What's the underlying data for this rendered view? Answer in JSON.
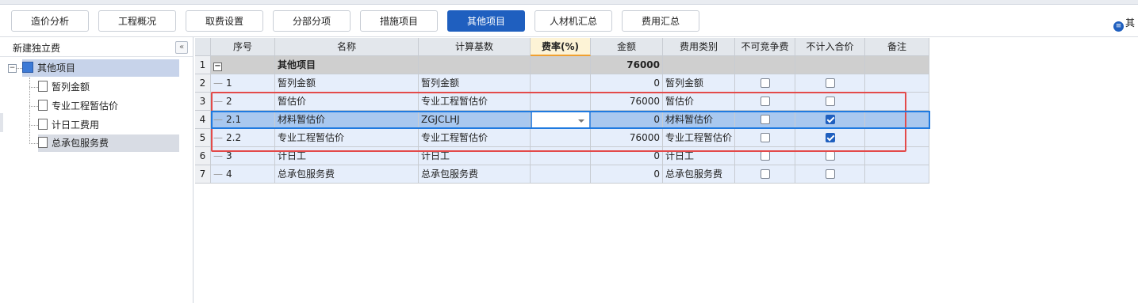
{
  "toolbar": {
    "tabs": [
      {
        "label": "造价分析"
      },
      {
        "label": "工程概况"
      },
      {
        "label": "取费设置"
      },
      {
        "label": "分部分项"
      },
      {
        "label": "措施项目"
      },
      {
        "label": "其他项目"
      },
      {
        "label": "人材机汇总"
      },
      {
        "label": "费用汇总"
      }
    ],
    "active_tab": "其他项目",
    "corner_text": "其"
  },
  "sidebar": {
    "title": "新建独立费",
    "collapse": "«",
    "root": {
      "label": "其他项目",
      "toggle": "−"
    },
    "items": [
      {
        "label": "暂列金额"
      },
      {
        "label": "专业工程暂估价"
      },
      {
        "label": "计日工费用"
      },
      {
        "label": "总承包服务费"
      }
    ]
  },
  "table": {
    "headers": {
      "seq": "序号",
      "name": "名称",
      "basis": "计算基数",
      "rate": "费率(%)",
      "amount": "金额",
      "category": "费用类别",
      "noncompete": "不可竞争费",
      "exclude": "不计入合价",
      "note": "备注"
    },
    "rows": [
      {
        "rownum": "1",
        "seq": "",
        "name": "其他项目",
        "basis": "",
        "rate": "",
        "amount": "76000",
        "category": "",
        "noncompete": null,
        "exclude": null,
        "note": ""
      },
      {
        "rownum": "2",
        "seq": "1",
        "name": "暂列金额",
        "basis": "暂列金额",
        "rate": "",
        "amount": "0",
        "category": "暂列金额",
        "noncompete": false,
        "exclude": false,
        "note": ""
      },
      {
        "rownum": "3",
        "seq": "2",
        "name": "暂估价",
        "basis": "专业工程暂估价",
        "rate": "",
        "amount": "76000",
        "category": "暂估价",
        "noncompete": false,
        "exclude": false,
        "note": ""
      },
      {
        "rownum": "4",
        "seq": "2.1",
        "name": "材料暂估价",
        "basis": "ZGJCLHJ",
        "rate": "",
        "amount": "0",
        "category": "材料暂估价",
        "noncompete": false,
        "exclude": true,
        "note": ""
      },
      {
        "rownum": "5",
        "seq": "2.2",
        "name": "专业工程暂估价",
        "basis": "专业工程暂估价",
        "rate": "",
        "amount": "76000",
        "category": "专业工程暂估价",
        "noncompete": false,
        "exclude": true,
        "note": ""
      },
      {
        "rownum": "6",
        "seq": "3",
        "name": "计日工",
        "basis": "计日工",
        "rate": "",
        "amount": "0",
        "category": "计日工",
        "noncompete": false,
        "exclude": false,
        "note": ""
      },
      {
        "rownum": "7",
        "seq": "4",
        "name": "总承包服务费",
        "basis": "总承包服务费",
        "rate": "",
        "amount": "0",
        "category": "总承包服务费",
        "noncompete": false,
        "exclude": false,
        "note": ""
      }
    ]
  },
  "colors": {
    "accent": "#1f5fbf",
    "highlight_box": "#e34a4a",
    "selected_row": "#a9c8ef"
  }
}
